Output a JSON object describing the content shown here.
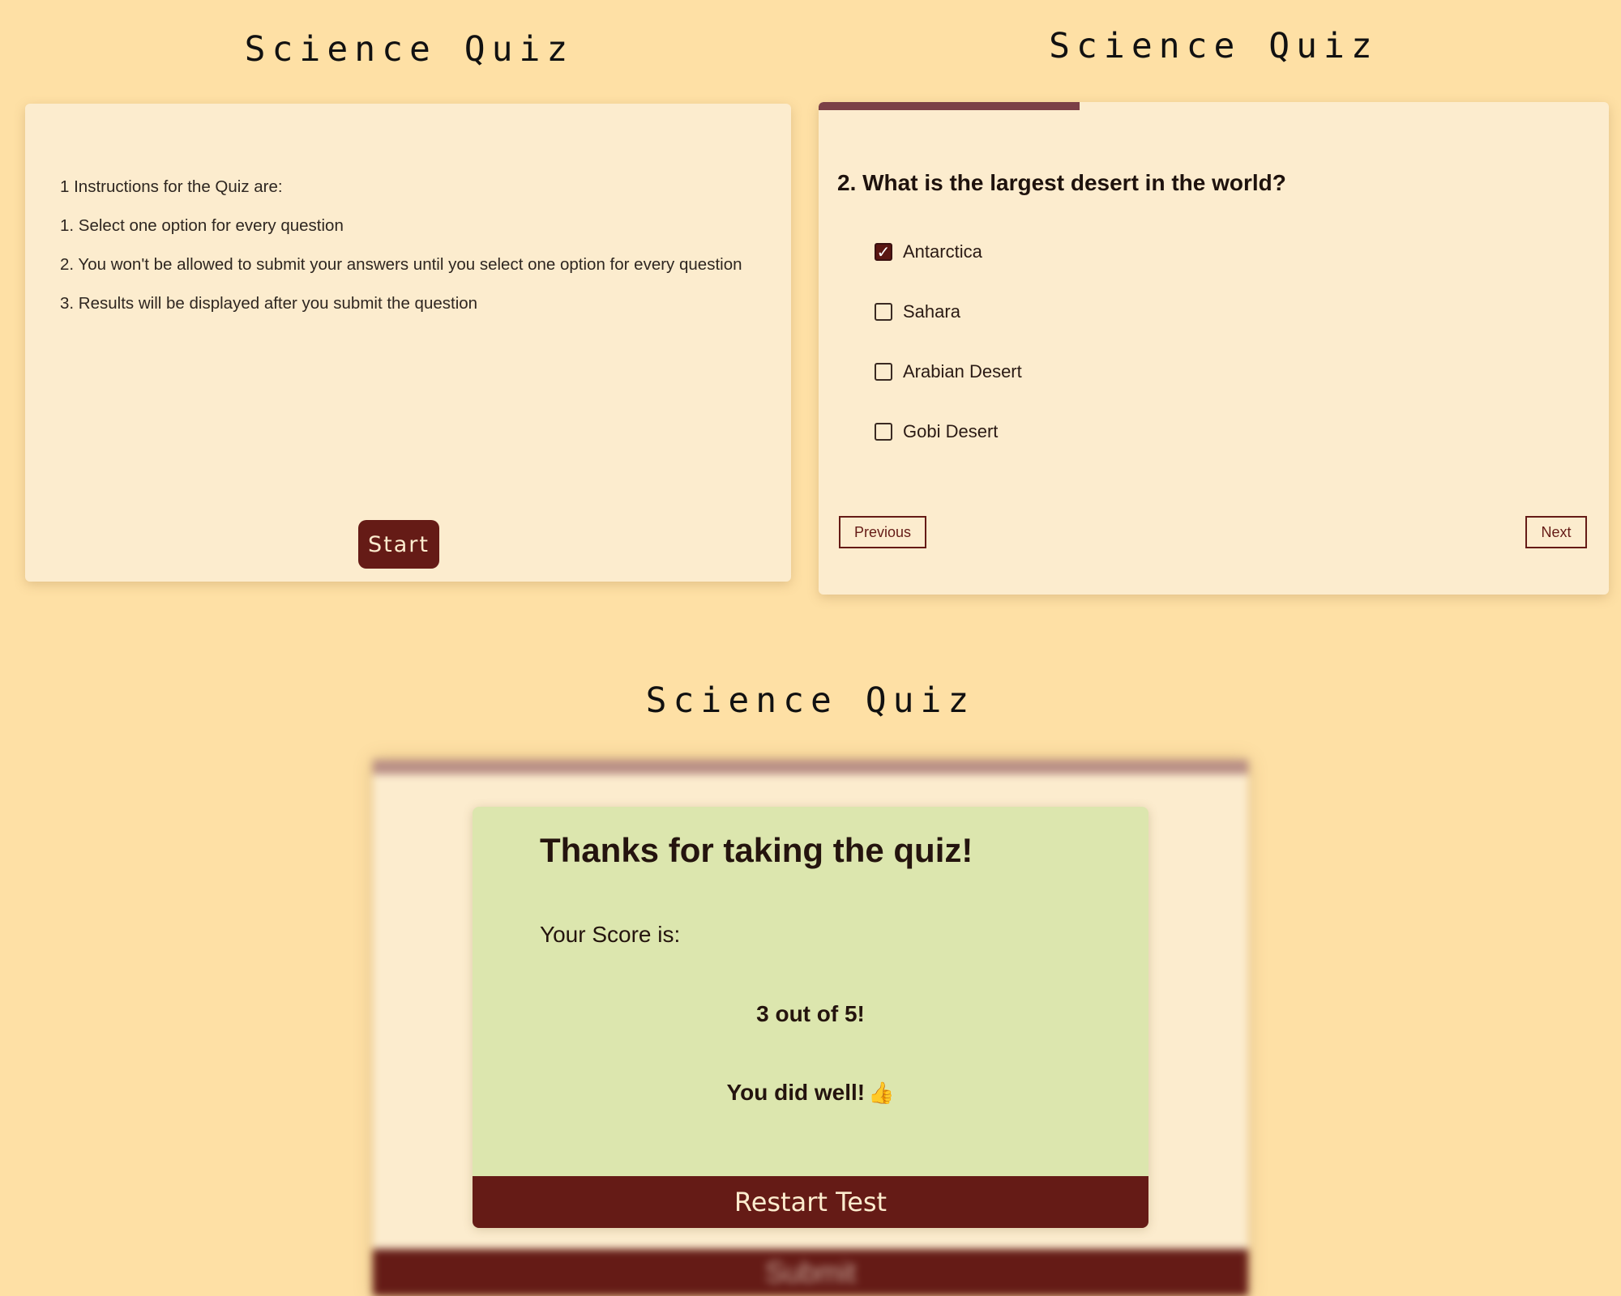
{
  "instructions_screen": {
    "title": "Science Quiz",
    "lines": [
      "1 Instructions for the Quiz are:",
      "1. Select one option for every question",
      "2. You won't be allowed to submit your answers until you select one option for every question",
      "3. Results will be displayed after you submit the question"
    ],
    "start_label": "Start"
  },
  "question_screen": {
    "title": "Science Quiz",
    "progress_fraction": 0.33,
    "progress_color": "#7b3f46",
    "question": "2. What is the largest desert in the world?",
    "options": [
      {
        "label": "Antarctica",
        "checked": true
      },
      {
        "label": "Sahara",
        "checked": false
      },
      {
        "label": "Arabian Desert",
        "checked": false
      },
      {
        "label": "Gobi Desert",
        "checked": false
      }
    ],
    "previous_label": "Previous",
    "next_label": "Next"
  },
  "result_screen": {
    "title": "Science Quiz",
    "heading": "Thanks for taking the quiz!",
    "score_label": "Your Score is:",
    "score_value": "3 out of 5!",
    "message": "You did well!",
    "message_icon": "thumbs-up-icon",
    "restart_label": "Restart Test",
    "background_submit_label": "Submit"
  },
  "colors": {
    "page_background": "#fee0a5",
    "card_background": "#fcecce",
    "accent": "#651b16",
    "result_card_background": "#dce6ae"
  }
}
